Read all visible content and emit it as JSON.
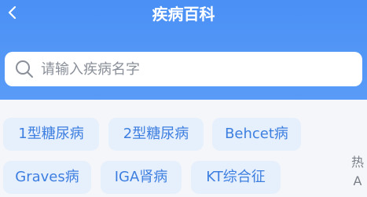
{
  "header": {
    "title": "疾病百科",
    "back_icon": "chevron-left-icon",
    "background_color": "#4a90f5"
  },
  "search": {
    "placeholder": "请输入疾病名字",
    "icon": "search-icon"
  },
  "tags": [
    {
      "label": "1型糖尿病"
    },
    {
      "label": "2型糖尿病"
    },
    {
      "label": "Behcet病"
    },
    {
      "label": "Graves病"
    },
    {
      "label": "IGA肾病"
    },
    {
      "label": "KT综合征"
    }
  ],
  "tag_colors": {
    "background": "#e6effc",
    "text": "#3d7fe0"
  },
  "index_bar": {
    "items": [
      "热",
      "A"
    ]
  }
}
